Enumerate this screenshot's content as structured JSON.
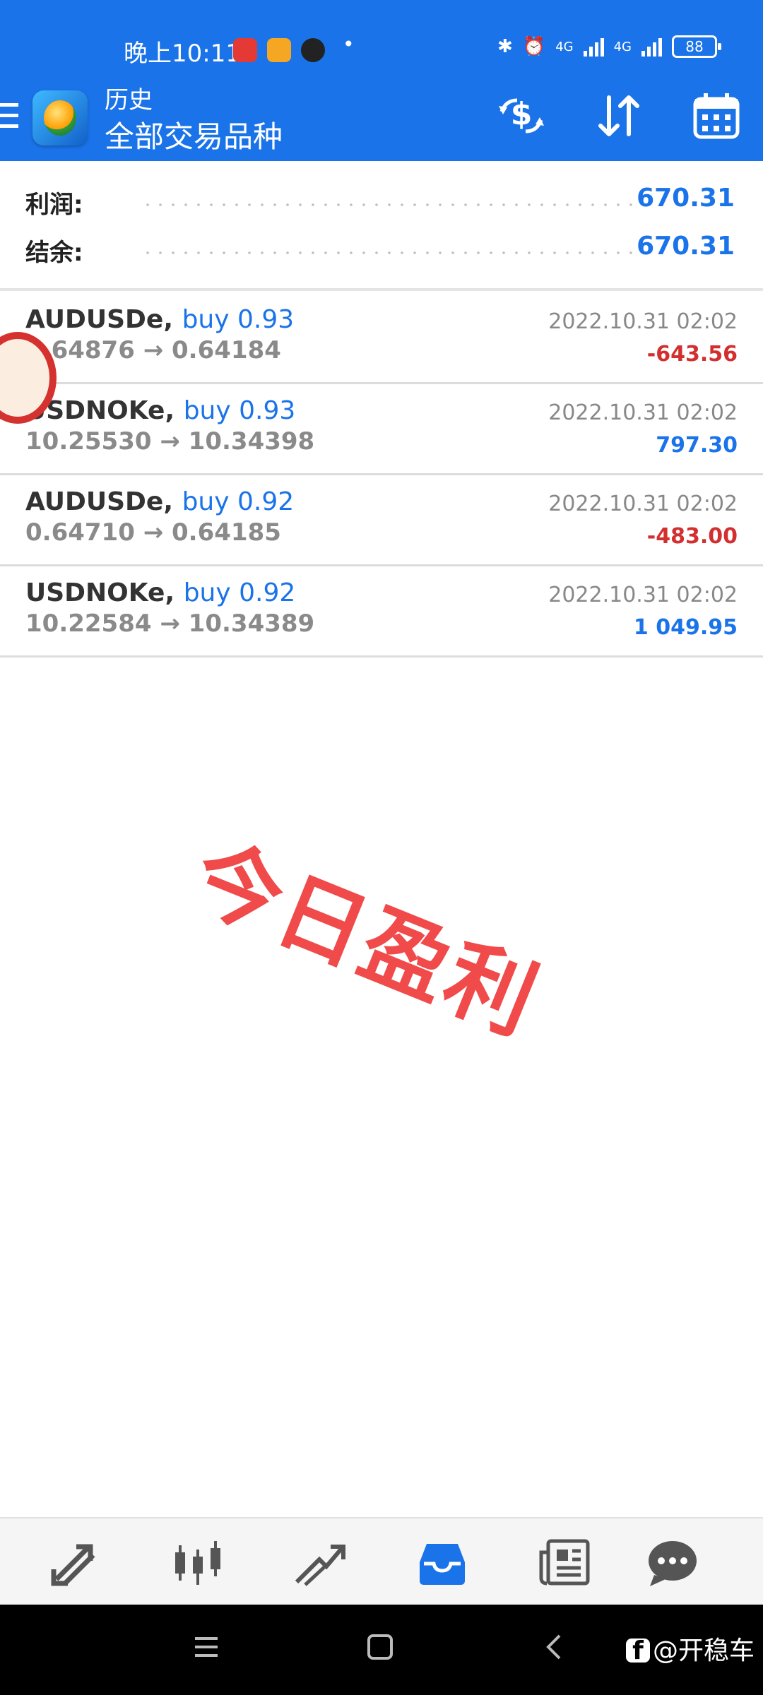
{
  "status_bar": {
    "time": "晚上10:11",
    "network_1": "4G",
    "network_2": "4G",
    "battery": "88"
  },
  "header": {
    "title": "历史",
    "subtitle": "全部交易品种"
  },
  "summary": {
    "profit_label": "利润:",
    "profit_value": "670.31",
    "balance_label": "结余:",
    "balance_value": "670.31"
  },
  "trades": [
    {
      "symbol": "AUDUSDe,",
      "type": "buy 0.93",
      "prices": "0.64876 → 0.64184",
      "time": "2022.10.31 02:02",
      "profit": "-643.56",
      "profit_color": "#d32f2f"
    },
    {
      "symbol": "USDNOKe,",
      "type": "buy 0.93",
      "prices": "10.25530 → 10.34398",
      "time": "2022.10.31 02:02",
      "profit": "797.30",
      "profit_color": "#1a73e8"
    },
    {
      "symbol": "AUDUSDe,",
      "type": "buy 0.92",
      "prices": "0.64710 → 0.64185",
      "time": "2022.10.31 02:02",
      "profit": "-483.00",
      "profit_color": "#d32f2f"
    },
    {
      "symbol": "USDNOKe,",
      "type": "buy 0.92",
      "prices": "10.22584 → 10.34389",
      "time": "2022.10.31 02:02",
      "profit": "1 049.95",
      "profit_color": "#1a73e8"
    }
  ],
  "watermark": {
    "stamp": "今日盈利",
    "credit": "@开稳车"
  },
  "bottom_nav": {
    "items": [
      "quotes-icon",
      "chart-icon",
      "trade-icon",
      "history-icon",
      "news-icon",
      "chat-icon"
    ],
    "active": "history-icon"
  },
  "colors": {
    "header": "#1a73e8",
    "profit_positive": "#1a73e8",
    "profit_negative": "#d32f2f"
  }
}
